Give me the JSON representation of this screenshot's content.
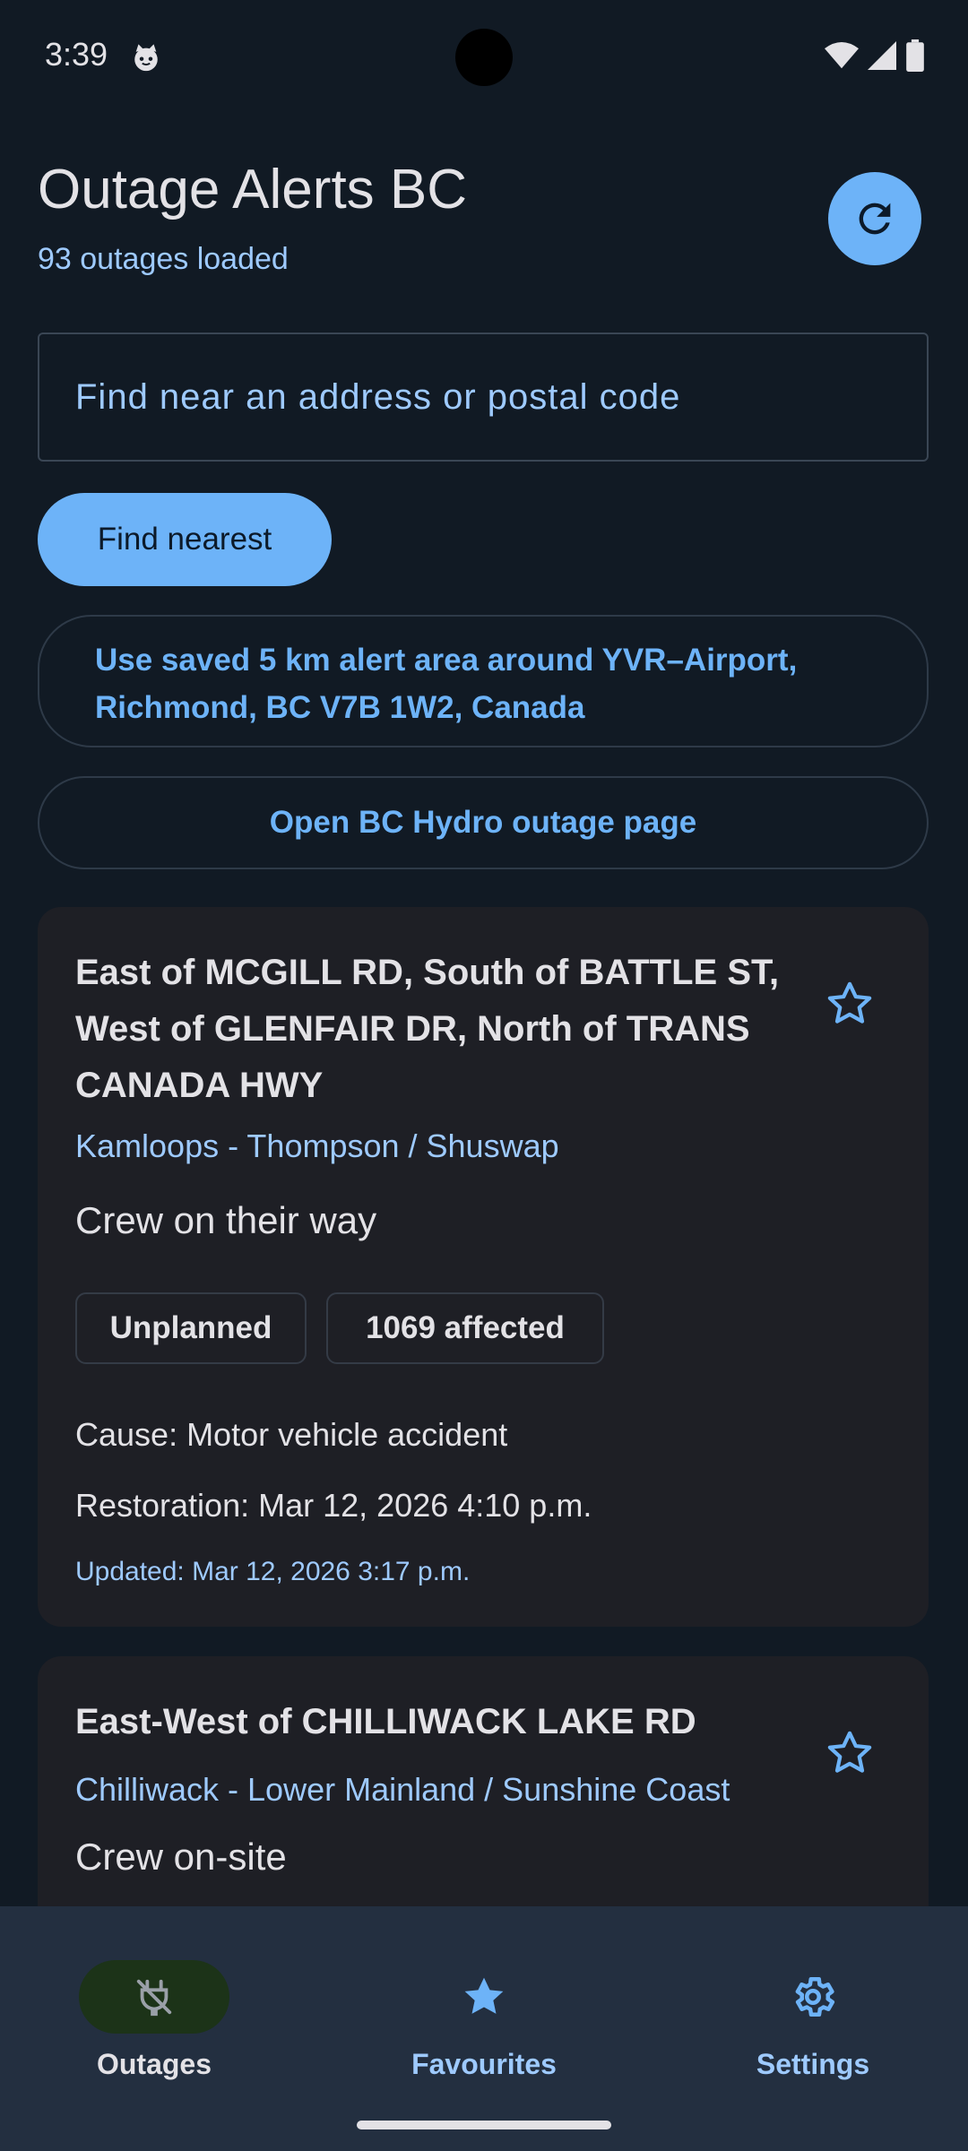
{
  "status_bar": {
    "time": "3:39"
  },
  "header": {
    "title": "Outage Alerts BC",
    "subtitle": "93 outages loaded"
  },
  "search": {
    "placeholder": "Find near an address or postal code",
    "value": ""
  },
  "actions": {
    "find_nearest": "Find nearest",
    "alert_area": "Use saved 5 km alert area around YVR–Airport, Richmond, BC V7B 1W2, Canada",
    "hydro_page": "Open BC Hydro outage page"
  },
  "outages": [
    {
      "title": "East of MCGILL RD, South of BATTLE ST, West of GLENFAIR DR, North of TRANS CANADA HWY",
      "region": "Kamloops - Thompson / Shuswap",
      "status": "Crew on their way",
      "type": "Unplanned",
      "affected": "1069 affected",
      "cause": "Cause: Motor vehicle accident",
      "restoration": "Restoration: Mar 12, 2026 4:10 p.m.",
      "updated": "Updated: Mar 12, 2026 3:17 p.m."
    },
    {
      "title": "East-West of CHILLIWACK LAKE RD",
      "region": "Chilliwack - Lower Mainland / Sunshine Coast",
      "status": "Crew on-site"
    }
  ],
  "nav": {
    "items": [
      {
        "label": "Outages",
        "icon": "power-off-icon",
        "active": true
      },
      {
        "label": "Favourites",
        "icon": "star-icon",
        "active": false
      },
      {
        "label": "Settings",
        "icon": "gear-icon",
        "active": false
      }
    ]
  },
  "colors": {
    "background": "#111a24",
    "accent": "#6db3f8",
    "card": "#1e1f25",
    "nav": "#232f40"
  }
}
